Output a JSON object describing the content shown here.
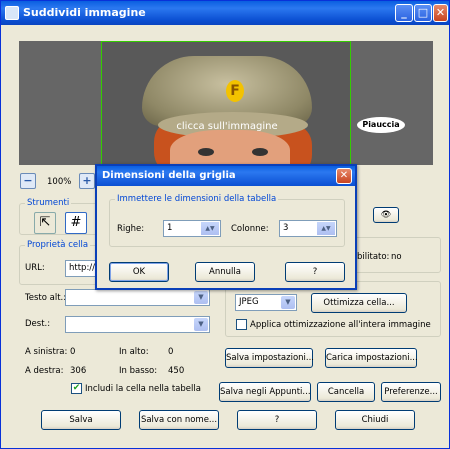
{
  "window": {
    "title": "Suddividi immagine"
  },
  "preview": {
    "hint": "clicca sull'immagine",
    "logo_text": "Piauccia",
    "badge_glyph": "F"
  },
  "zoom": {
    "level": "100%"
  },
  "tools": {
    "label": "Strumenti"
  },
  "cell_props": {
    "label": "Proprietà cella",
    "url_label": "URL:",
    "url_value": "http://",
    "alt_label": "Testo alt.:",
    "alt_value": "",
    "dest_label": "Dest.:",
    "dest_value": "",
    "left_label": "A sinistra:",
    "left_value": "0",
    "top_label": "In alto:",
    "top_value": "0",
    "right_label": "A destra:",
    "right_value": "306",
    "bottom_label": "In basso:",
    "bottom_value": "450",
    "include_label": "Includi la cella nella tabella",
    "include_checked": true
  },
  "right_panel": {
    "enabled_label": "bilitato:",
    "enabled_value": "no",
    "format_value": "JPEG",
    "optimize_button": "Ottimizza cella...",
    "apply_all_label": "Applica ottimizzazione all'intera immagine",
    "apply_all_checked": false,
    "save_settings": "Salva impostazioni...",
    "load_settings": "Carica impostazioni...",
    "copy_clipboard": "Salva negli Appunti...",
    "delete": "Cancella",
    "preferences": "Preferenze..."
  },
  "footer": {
    "save": "Salva",
    "save_as": "Salva con nome...",
    "help": "?",
    "close": "Chiudi"
  },
  "dialog": {
    "title": "Dimensioni della griglia",
    "group_label": "Immettere le dimensioni della tabella",
    "rows_label": "Righe:",
    "rows_value": "1",
    "cols_label": "Colonne:",
    "cols_value": "3",
    "ok": "OK",
    "cancel": "Annulla",
    "help": "?"
  },
  "colors": {
    "title_blue": "#0a5fe0",
    "frame_green": "#33cc00",
    "group_label_blue": "#0046d5"
  }
}
